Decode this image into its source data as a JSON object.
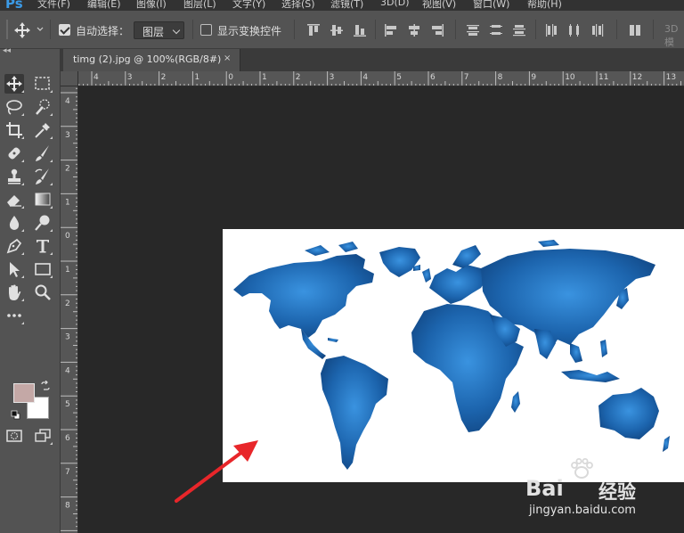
{
  "app": {
    "logo": "Ps"
  },
  "menu": [
    "文件(F)",
    "编辑(E)",
    "图像(I)",
    "图层(L)",
    "文字(Y)",
    "选择(S)",
    "滤镜(T)",
    "3D(D)",
    "视图(V)",
    "窗口(W)",
    "帮助(H)"
  ],
  "options": {
    "auto_select_label": "自动选择：",
    "auto_select_value": "图层",
    "show_transform_label": "显示变换控件",
    "mode_3d_label": "3D 模"
  },
  "tab": {
    "title": "timg (2).jpg @ 100%(RGB/8#)",
    "close": "×"
  },
  "ruler": {
    "h_labels": [
      "4",
      "3",
      "2",
      "1",
      "0",
      "1",
      "2",
      "3",
      "4",
      "5",
      "6",
      "7",
      "8",
      "9",
      "10",
      "11",
      "12",
      "13"
    ],
    "v_labels": [
      "4",
      "3",
      "2",
      "1",
      "0",
      "1",
      "2",
      "3",
      "4",
      "5",
      "6",
      "7",
      "8"
    ]
  },
  "colors": {
    "foreground": "#c4a8a6",
    "background": "#ffffff",
    "annotation_arrow": "#e8262a",
    "map_fill": "#1a5ea8"
  },
  "watermark": {
    "brand": "Bai",
    "brand2": "经验",
    "url": "jingyan.baidu.com"
  }
}
